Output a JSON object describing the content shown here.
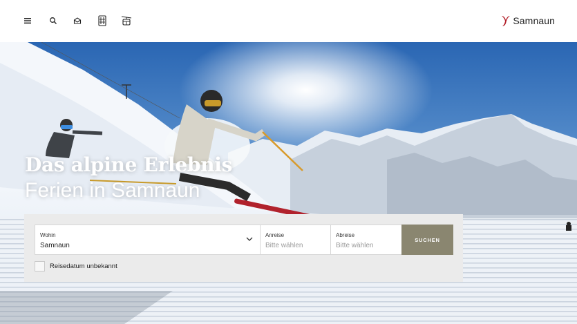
{
  "header": {
    "menu_icon": "hamburger-menu-icon",
    "search_icon": "search-icon",
    "mail_icon": "mail-icon",
    "app_icon": "calendar-grid-icon",
    "cablecar_icon": "cable-car-icon",
    "logo_text": "Samnaun",
    "logo_color": "#b3202a"
  },
  "hero": {
    "title_line1": "Das alpine Erlebnis",
    "title_line2": "Ferien in Samnaun"
  },
  "search": {
    "where_label": "Wohin",
    "where_value": "Samnaun",
    "arrival_label": "Anreise",
    "arrival_placeholder": "Bitte wählen",
    "departure_label": "Abreise",
    "departure_placeholder": "Bitte wählen",
    "submit_label": "SUCHEN",
    "submit_color": "#8a8670",
    "unknown_date_label": "Reisedatum unbekannt"
  }
}
